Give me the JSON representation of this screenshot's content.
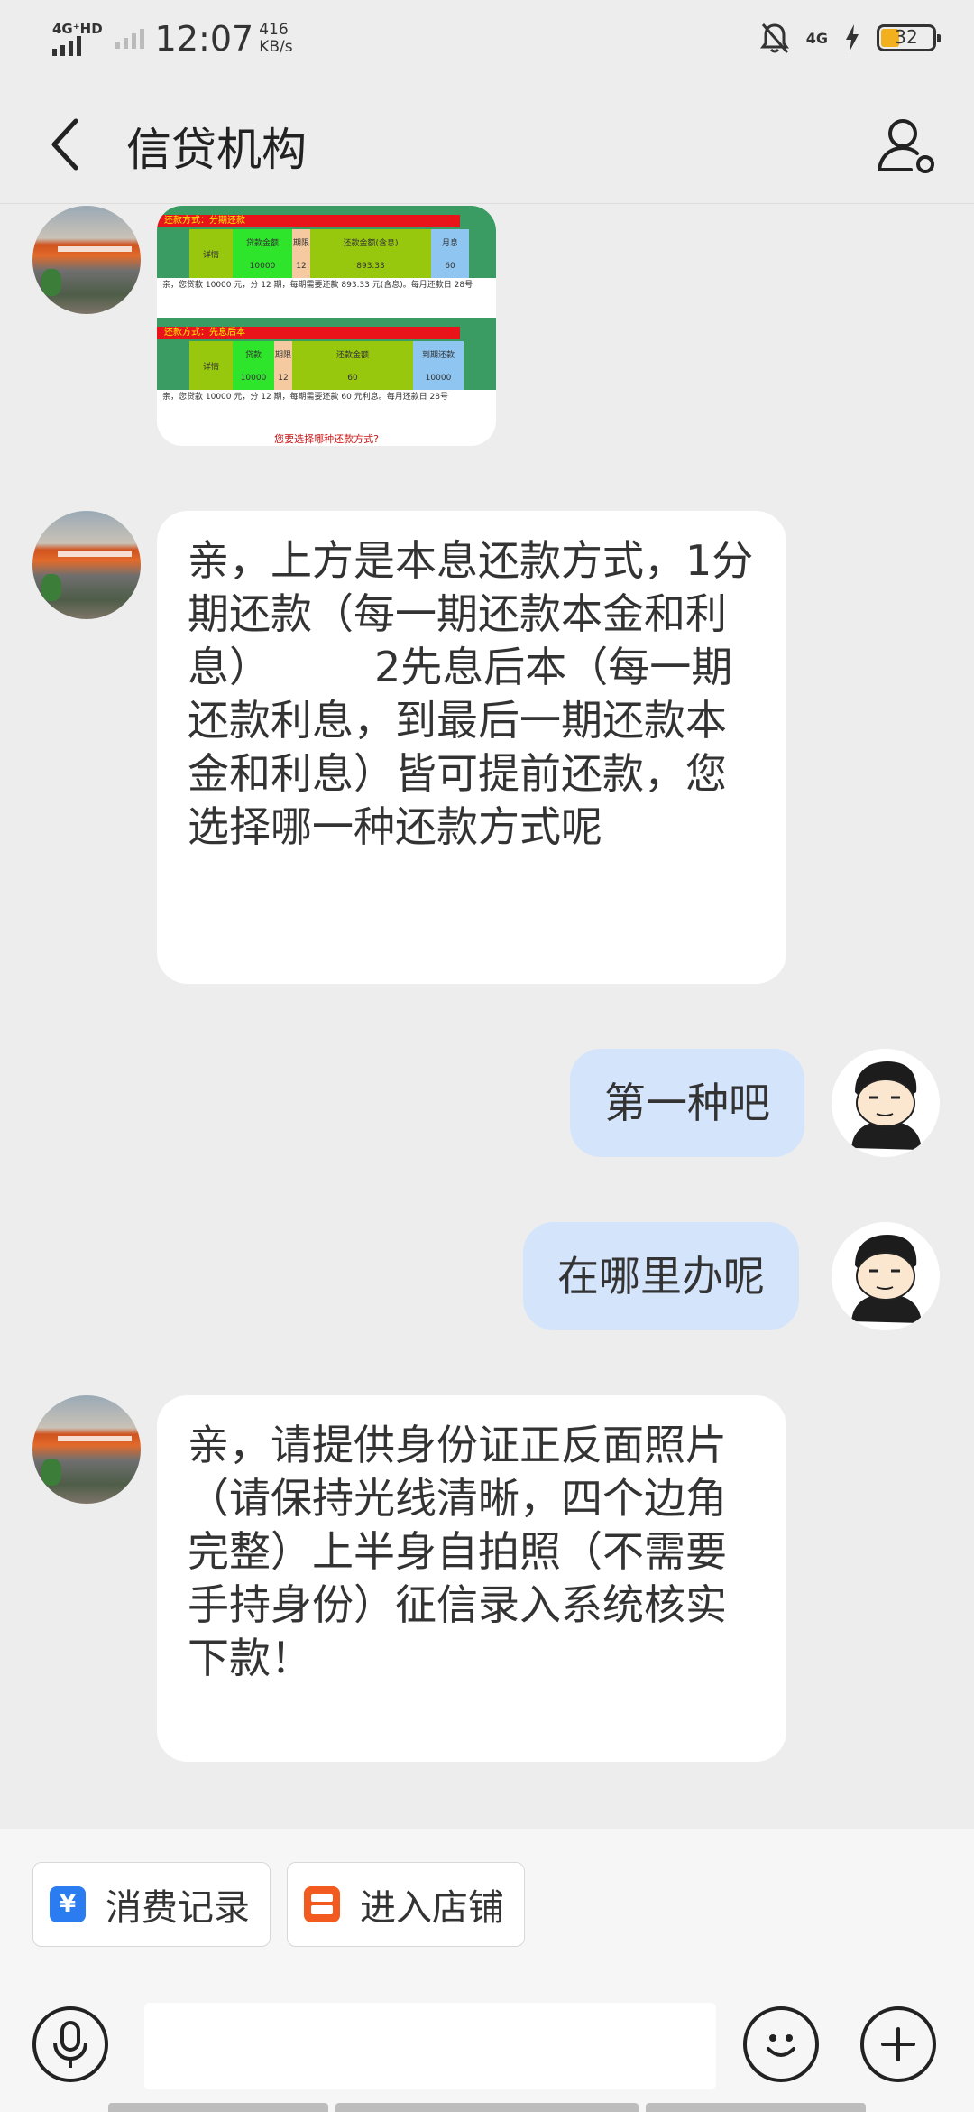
{
  "status_bar": {
    "network_tag": "4G⁺HD",
    "time": "12:07",
    "speed_value": "416",
    "speed_unit": "KB/s",
    "right_network": "4G",
    "battery": "32"
  },
  "header": {
    "title": "信贷机构"
  },
  "image_message": {
    "table1_header": "还款方式：分期还款",
    "table1_cols": [
      "详情",
      "贷款金额",
      "期限",
      "还款金额(含息)",
      "月息"
    ],
    "table1_vals": [
      "10000",
      "12",
      "893.33",
      "60"
    ],
    "table1_note": "亲，您贷款 10000 元，分 12 期，每期需要还款 893.33 元(含息)。每月还款日 28号",
    "table2_header": "还款方式：先息后本",
    "table2_cols": [
      "详情",
      "贷款",
      "期限",
      "还款金额",
      "到期还款"
    ],
    "table2_vals": [
      "10000",
      "12",
      "60",
      "10000"
    ],
    "table2_note": "亲，您贷款 10000 元，分 12 期，每期需要还款 60 元利息。每月还款日 28号",
    "question": "您要选择哪种还款方式?"
  },
  "messages": {
    "m1": "亲，上方是本息还款方式，1分期还款（每一期还款本金和利息）　　　2先息后本（每一期还款利息，到最后一期还款本金和利息）皆可提前还款，您选择哪一种还款方式呢",
    "m2": "第一种吧",
    "m3": "在哪里办呢",
    "m4": "亲，请提供身份证正反面照片（请保持光线清晰，四个边角完整）上半身自拍照（不需要手持身份）征信录入系统核实下款！"
  },
  "quick_actions": {
    "records_icon": "¥",
    "records": "消费记录",
    "store": "进入店铺"
  },
  "input": {
    "placeholder": ""
  },
  "icons": {
    "back": "chevron-left-icon",
    "profile": "user-settings-icon",
    "mic": "microphone-icon",
    "emoji": "smiley-icon",
    "plus": "plus-icon"
  },
  "colors": {
    "background": "#ededed",
    "sent_bubble": "#d3e4fb",
    "records_icon": "#2b7cf0",
    "store_icon": "#f25a1f",
    "battery_fill": "#f2b01e"
  }
}
